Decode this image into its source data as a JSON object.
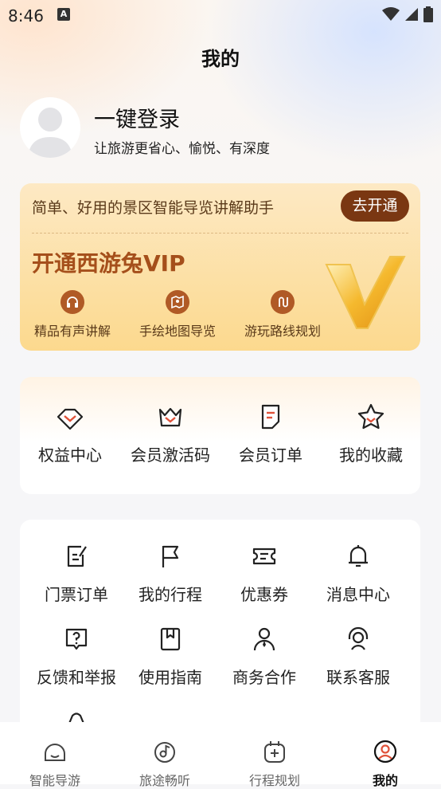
{
  "status_bar": {
    "time": "8:46",
    "badge": "A"
  },
  "page_title": "我的",
  "login": {
    "title": "一键登录",
    "subtitle": "让旅游更省心、愉悦、有深度"
  },
  "vip": {
    "tagline": "简单、好用的景区智能导览讲解助手",
    "cta": "去开通",
    "title": "开通西游兔VIP",
    "features": [
      {
        "label": "精品有声讲解",
        "icon": "headphones-icon"
      },
      {
        "label": "手绘地图导览",
        "icon": "map-pin-icon"
      },
      {
        "label": "游玩路线规划",
        "icon": "route-icon"
      }
    ]
  },
  "member_items": [
    {
      "label": "权益中心",
      "icon": "diamond-icon"
    },
    {
      "label": "会员激活码",
      "icon": "crown-icon"
    },
    {
      "label": "会员订单",
      "icon": "order-icon"
    },
    {
      "label": "我的收藏",
      "icon": "star-icon"
    }
  ],
  "service_items": [
    {
      "label": "门票订单",
      "icon": "ticket-edit-icon"
    },
    {
      "label": "我的行程",
      "icon": "flag-icon"
    },
    {
      "label": "优惠券",
      "icon": "coupon-icon"
    },
    {
      "label": "消息中心",
      "icon": "bell-icon"
    },
    {
      "label": "反馈和举报",
      "icon": "question-icon"
    },
    {
      "label": "使用指南",
      "icon": "guide-book-icon"
    },
    {
      "label": "商务合作",
      "icon": "person-icon"
    },
    {
      "label": "联系客服",
      "icon": "headset-icon"
    }
  ],
  "tabs": [
    {
      "label": "智能导游",
      "icon": "home-icon"
    },
    {
      "label": "旅途畅听",
      "icon": "music-icon"
    },
    {
      "label": "行程规划",
      "icon": "plan-icon"
    },
    {
      "label": "我的",
      "icon": "profile-icon"
    }
  ],
  "colors": {
    "accent": "#a54f1b",
    "vip_button": "#7a3712",
    "member_icon": "#e0523a"
  }
}
